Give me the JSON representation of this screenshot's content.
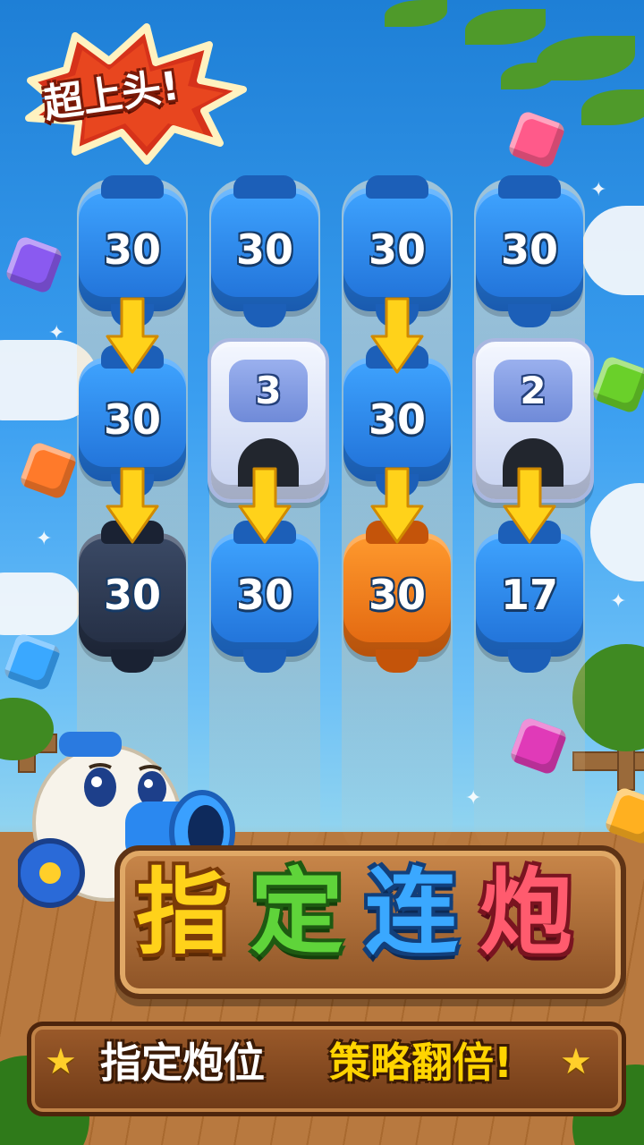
{
  "badge": {
    "text": "超上头!"
  },
  "columns": [
    {
      "tiles": [
        {
          "kind": "bottle",
          "color": "blue",
          "value": "30"
        },
        {
          "kind": "bottle",
          "color": "blue",
          "value": "30"
        },
        {
          "kind": "bottle",
          "color": "navy",
          "value": "30"
        }
      ]
    },
    {
      "tiles": [
        {
          "kind": "bottle",
          "color": "blue",
          "value": "30"
        },
        {
          "kind": "slot",
          "color": "white",
          "value": "3"
        },
        {
          "kind": "bottle",
          "color": "blue",
          "value": "30"
        }
      ]
    },
    {
      "tiles": [
        {
          "kind": "bottle",
          "color": "blue",
          "value": "30"
        },
        {
          "kind": "bottle",
          "color": "blue",
          "value": "30"
        },
        {
          "kind": "bottle",
          "color": "orange",
          "value": "30"
        }
      ]
    },
    {
      "tiles": [
        {
          "kind": "bottle",
          "color": "blue",
          "value": "30"
        },
        {
          "kind": "slot",
          "color": "white",
          "value": "2"
        },
        {
          "kind": "bottle",
          "color": "blue",
          "value": "17"
        }
      ]
    }
  ],
  "title": {
    "chars": [
      "指",
      "定",
      "连",
      "炮"
    ],
    "colors": [
      "#ffd21a",
      "#5fd43a",
      "#3aa8ff",
      "#ff5b6e"
    ]
  },
  "banner": {
    "left_text": "指定炮位",
    "right_text": "策略翻倍!"
  },
  "colors": {
    "blue": "#2a88f0",
    "navy": "#2c3850",
    "orange": "#f07a1a",
    "arrow": "#ffd21a"
  },
  "gems": [
    "pink",
    "purple",
    "green",
    "orange",
    "blue",
    "magenta",
    "amber"
  ]
}
